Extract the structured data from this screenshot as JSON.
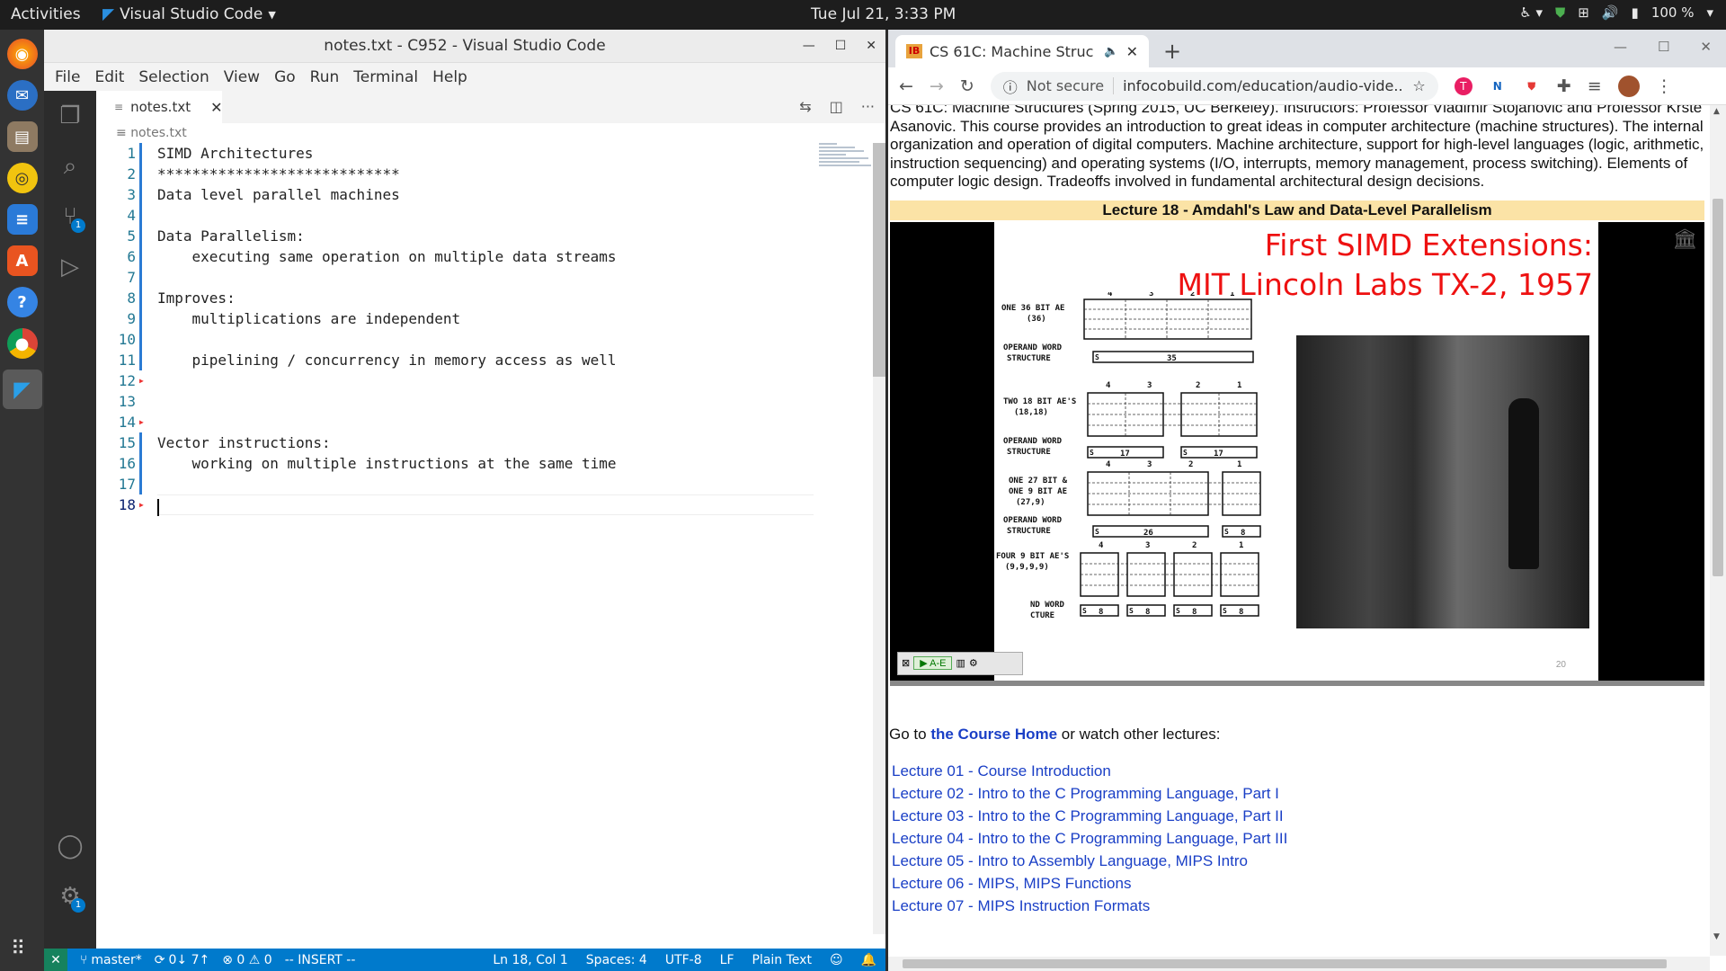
{
  "topbar": {
    "activities": "Activities",
    "app": "Visual Studio Code",
    "clock": "Tue Jul 21,  3:33 PM",
    "battery": "100 %"
  },
  "vscode": {
    "title": "notes.txt - C952 - Visual Studio Code",
    "menu": [
      "File",
      "Edit",
      "Selection",
      "View",
      "Go",
      "Run",
      "Terminal",
      "Help"
    ],
    "tab": "notes.txt",
    "breadcrumb": "notes.txt",
    "lines": [
      {
        "n": "1",
        "t": "SIMD Architectures"
      },
      {
        "n": "2",
        "t": "****************************"
      },
      {
        "n": "3",
        "t": "Data level parallel machines"
      },
      {
        "n": "4",
        "t": ""
      },
      {
        "n": "5",
        "t": "Data Parallelism:"
      },
      {
        "n": "6",
        "t": "    executing same operation on multiple data streams"
      },
      {
        "n": "7",
        "t": ""
      },
      {
        "n": "8",
        "t": "Improves:"
      },
      {
        "n": "9",
        "t": "    multiplications are independent"
      },
      {
        "n": "10",
        "t": ""
      },
      {
        "n": "11",
        "t": "    pipelining / concurrency in memory access as well"
      },
      {
        "n": "12",
        "t": ""
      },
      {
        "n": "13",
        "t": ""
      },
      {
        "n": "14",
        "t": ""
      },
      {
        "n": "15",
        "t": "Vector instructions:"
      },
      {
        "n": "16",
        "t": "    working on multiple instructions at the same time"
      },
      {
        "n": "17",
        "t": ""
      },
      {
        "n": "18",
        "t": ""
      }
    ],
    "status": {
      "branch": "master*",
      "sync": "0↓ 7↑",
      "problems": "⊗ 0 ⚠ 0",
      "mode": "-- INSERT --",
      "position": "Ln 18, Col 1",
      "spaces": "Spaces: 4",
      "encoding": "UTF-8",
      "eol": "LF",
      "language": "Plain Text"
    },
    "badges": {
      "scm": "1",
      "settings": "1"
    }
  },
  "chrome": {
    "tab_title": "CS 61C: Machine Struc",
    "omnibox": {
      "security": "Not secure",
      "url": "infocobuild.com/education/audio-vide..."
    },
    "description": "CS 61C: Machine Structures (Spring 2015, UC Berkeley). Instructors: Professor Vladimir Stojanovic and Professor Krste Asanovic. This course provides an introduction to great ideas in computer architecture (machine structures). The internal organization and operation of digital computers. Machine architecture, support for high-level languages (logic, arithmetic, instruction sequencing) and operating systems (I/O, interrupts, memory management, process switching). Elements of computer logic design. Tradeoffs involved in fundamental architectural design decisions.",
    "lecture_title": "Lecture 18 - Amdahl's Law and Data-Level Parallelism",
    "slide": {
      "title_line1": "First SIMD Extensions:",
      "title_line2": "MIT Lincoln Labs TX-2, 1957",
      "number": "20",
      "labels": [
        "ONE 36 BIT AE\n(36)",
        "OPERAND WORD\nSTRUCTURE",
        "TWO 18 BIT AE'S\n(18,18)",
        "OPERAND WORD\nSTRUCTURE",
        "ONE 27 BIT &\nONE 9 BIT AE\n(27,9)",
        "OPERAND WORD\nSTRUCTURE",
        "FOUR 9 BIT AE'S\n(9,9,9,9)",
        "ND WORD\nCTURE"
      ],
      "values": [
        "35",
        "17",
        "17",
        "26",
        "8",
        "8",
        "8",
        "8",
        "8"
      ],
      "player_button": "A-E"
    },
    "goto_prefix": "Go to ",
    "goto_link": "the Course Home",
    "goto_suffix": " or watch other lectures:",
    "lectures": [
      "Lecture 01 - Course Introduction",
      "Lecture 02 - Intro to the C Programming Language, Part I",
      "Lecture 03 - Intro to the C Programming Language, Part II",
      "Lecture 04 - Intro to the C Programming Language, Part III",
      "Lecture 05 - Intro to Assembly Language, MIPS Intro",
      "Lecture 06 - MIPS, MIPS Functions",
      "Lecture 07 - MIPS Instruction Formats"
    ]
  }
}
